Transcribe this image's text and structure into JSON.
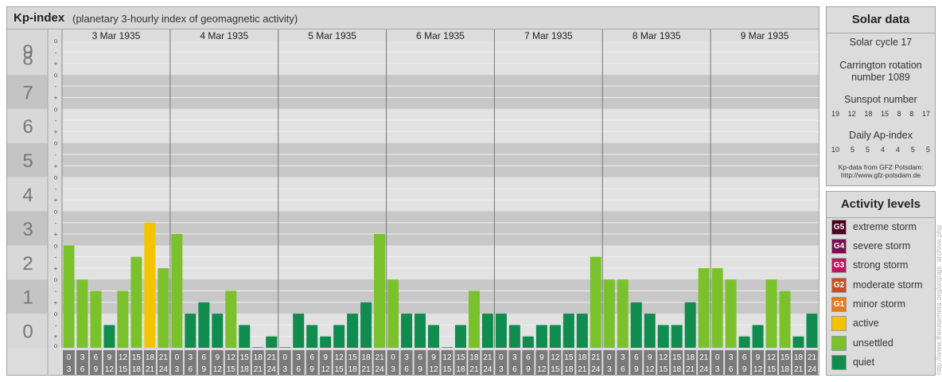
{
  "header": {
    "title": "Kp-index",
    "subtitle": "(planetary 3-hourly index of geomagnetic activity)"
  },
  "colors": {
    "quiet": "#0f8c4e",
    "unsettled": "#7ac12c",
    "active": "#f5c400",
    "g1": "#e57a1e",
    "g2": "#d24a1e",
    "g3": "#c0125e",
    "g4": "#7a0e4e",
    "g5": "#4a0020"
  },
  "chart_data": {
    "type": "bar",
    "title": "Kp-index",
    "ylim": [
      0,
      9
    ],
    "y_major_ticks": [
      "0",
      "1",
      "2",
      "3",
      "4",
      "5",
      "6",
      "7",
      "8",
      "9"
    ],
    "y_minor_ticks": [
      "o",
      "+",
      "-"
    ],
    "days": [
      "3 Mar 1935",
      "4 Mar 1935",
      "5 Mar 1935",
      "6 Mar 1935",
      "7 Mar 1935",
      "8 Mar 1935",
      "9 Mar 1935"
    ],
    "hour_start_labels": [
      "0",
      "3",
      "6",
      "9",
      "12",
      "15",
      "18",
      "21"
    ],
    "hour_end_labels": [
      "3",
      "6",
      "9",
      "12",
      "15",
      "18",
      "21",
      "24"
    ],
    "values": [
      [
        3.0,
        2.0,
        1.667,
        0.667,
        1.667,
        2.667,
        3.667,
        2.333
      ],
      [
        3.333,
        1.0,
        1.333,
        1.0,
        1.667,
        0.667,
        0.0,
        0.333
      ],
      [
        0.0,
        1.0,
        0.667,
        0.333,
        0.667,
        1.0,
        1.333,
        3.333
      ],
      [
        2.0,
        1.0,
        1.0,
        0.667,
        0.0,
        0.667,
        1.667,
        1.0
      ],
      [
        1.0,
        0.667,
        0.333,
        0.667,
        0.667,
        1.0,
        1.0,
        2.667
      ],
      [
        2.0,
        2.0,
        1.333,
        1.0,
        0.667,
        0.667,
        1.333,
        2.333
      ],
      [
        2.333,
        2.0,
        0.333,
        0.667,
        2.0,
        1.667,
        0.333,
        1.0
      ]
    ]
  },
  "solar": {
    "title": "Solar data",
    "cycle": "Solar cycle 17",
    "carrington_line1": "Carrington rotation",
    "carrington_line2": "number 1089",
    "sunspot_label": "Sunspot number",
    "sunspot_values": [
      "19",
      "12",
      "18",
      "15",
      "8",
      "8",
      "17"
    ],
    "ap_label": "Daily Ap-index",
    "ap_values": [
      "10",
      "5",
      "5",
      "4",
      "4",
      "5",
      "5"
    ],
    "source_line1": "Kp-data from GFZ Potsdam:",
    "source_line2": "http://www.gfz-potsdam.de"
  },
  "activity": {
    "title": "Activity levels",
    "items": [
      {
        "badge": "G5",
        "label": "extreme storm",
        "color": "#4a0020"
      },
      {
        "badge": "G4",
        "label": "severe storm",
        "color": "#7a0e4e"
      },
      {
        "badge": "G3",
        "label": "strong storm",
        "color": "#c0125e"
      },
      {
        "badge": "G2",
        "label": "moderate storm",
        "color": "#d24a1e"
      },
      {
        "badge": "G1",
        "label": "minor storm",
        "color": "#e57a1e"
      },
      {
        "badge": "",
        "label": "active",
        "color": "#f5c400"
      },
      {
        "badge": "",
        "label": "unsettled",
        "color": "#7ac12c"
      },
      {
        "badge": "",
        "label": "quiet",
        "color": "#0f8c4e"
      }
    ]
  },
  "watermark": "http://www.theusemeta.org/org/api_archive.php"
}
